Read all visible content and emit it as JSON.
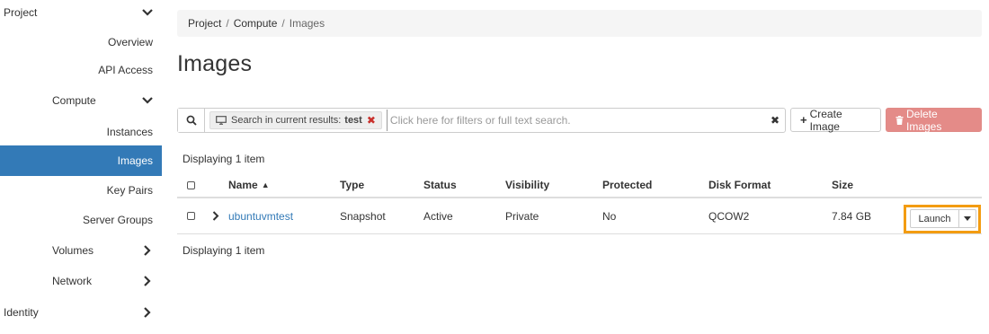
{
  "sidebar": {
    "project": "Project",
    "overview": "Overview",
    "api_access": "API Access",
    "compute": "Compute",
    "instances": "Instances",
    "images": "Images",
    "key_pairs": "Key Pairs",
    "server_groups": "Server Groups",
    "volumes": "Volumes",
    "network": "Network",
    "identity": "Identity"
  },
  "breadcrumb": {
    "items": [
      "Project",
      "Compute",
      "Images"
    ],
    "separator": "/"
  },
  "page_title": "Images",
  "toolbar": {
    "filter_chip_label": "Search in current results:",
    "filter_chip_value": "test",
    "filter_chip_remove": "✖",
    "search_placeholder": "Click here for filters or full text search.",
    "clear_glyph": "✖",
    "create_plus": "+",
    "create_label": "Create Image",
    "delete_icon": "🗑",
    "delete_label": "Delete Images"
  },
  "display_count_top": "Displaying 1 item",
  "display_count_bottom": "Displaying 1 item",
  "table": {
    "columns": {
      "name": "Name",
      "name_sort": "▲",
      "type": "Type",
      "status": "Status",
      "visibility": "Visibility",
      "protected": "Protected",
      "disk_format": "Disk Format",
      "size": "Size"
    },
    "rows": [
      {
        "name": "ubuntuvmtest",
        "type": "Snapshot",
        "status": "Active",
        "visibility": "Private",
        "protected": "No",
        "disk_format": "QCOW2",
        "size": "7.84 GB",
        "action": "Launch"
      }
    ]
  },
  "colors": {
    "active_nav": "#337ab7",
    "link": "#337ab7",
    "danger_button": "#e48b88",
    "highlight": "#f39c12"
  }
}
